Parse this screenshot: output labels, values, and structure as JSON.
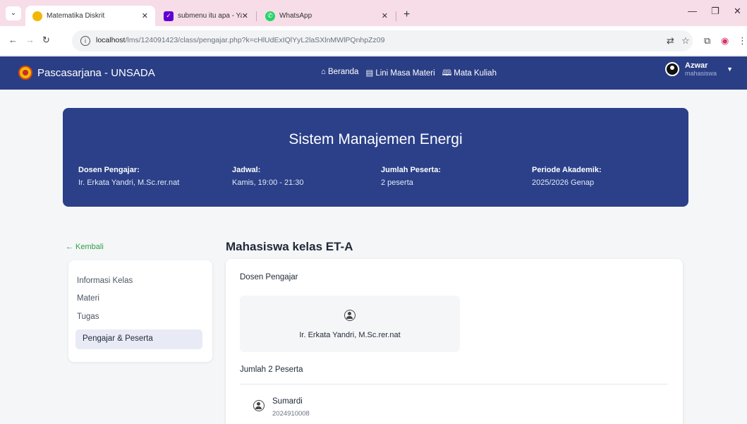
{
  "browser": {
    "tabs": [
      {
        "title": "Matematika Diskrit",
        "active": true
      },
      {
        "title": "submenu itu apa - Yahoo Hasil",
        "active": false
      },
      {
        "title": "WhatsApp",
        "active": false
      }
    ],
    "url_host": "localhost",
    "url_path": "/lms/124091423/class/pengajar.php?k=cHlUdExIQlYyL2laSXlnMWlPQnhpZz09",
    "new_tab_label": "+"
  },
  "navbar": {
    "brand": "Pascasarjana - UNSADA",
    "links": [
      {
        "icon": "home-icon",
        "label": "Beranda"
      },
      {
        "icon": "timeline-icon",
        "label": "Lini Masa Materi"
      },
      {
        "icon": "book-icon",
        "label": "Mata Kuliah"
      }
    ],
    "user_name": "Azwar",
    "user_role": "mahasiswa"
  },
  "course": {
    "title": "Sistem Manajemen Energi",
    "meta": [
      {
        "label": "Dosen Pengajar:",
        "value": "Ir. Erkata Yandri, M.Sc.rer.nat"
      },
      {
        "label": "Jadwal:",
        "value": "Kamis, 19:00 - 21:30"
      },
      {
        "label": "Jumlah Peserta:",
        "value": "2 peserta"
      },
      {
        "label": "Periode Akademik:",
        "value": "2025/2026 Genap"
      }
    ]
  },
  "sidebar": {
    "back_label": "← Kembali",
    "items": [
      {
        "label": "Informasi Kelas",
        "active": false
      },
      {
        "label": "Materi",
        "active": false
      },
      {
        "label": "Tugas",
        "active": false
      },
      {
        "label": "Pengajar & Peserta",
        "active": true
      }
    ]
  },
  "main": {
    "section_title": "Mahasiswa kelas ET-A",
    "lecturer_heading": "Dosen Pengajar",
    "lecturer_name": "Ir. Erkata Yandri, M.Sc.rer.nat",
    "participants_heading": "Jumlah 2 Peserta",
    "participants": [
      {
        "name": "Sumardi",
        "id": "2024910008"
      }
    ]
  },
  "colors": {
    "navbar_bg": "#2a3e85",
    "banner_bg": "#2b4089",
    "accent_green": "#2f9e44",
    "tabbar_bg": "#f7dde8"
  }
}
